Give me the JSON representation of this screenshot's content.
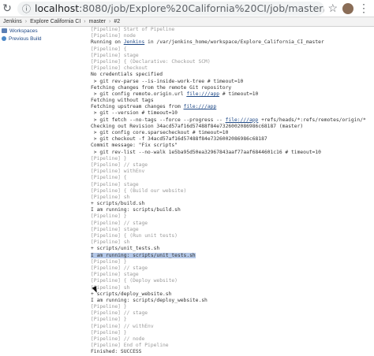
{
  "browser": {
    "url_host": "localhost",
    "url_path": ":8080/job/Explore%20California%20CI/job/master/2/console"
  },
  "breadcrumb": [
    "Jenkins",
    "Explore California CI",
    "master",
    "#2"
  ],
  "sidebar": {
    "items": [
      {
        "label": "Workspaces",
        "icon": "folder-icon"
      },
      {
        "label": "Previous Build",
        "icon": "build-icon"
      }
    ]
  },
  "console": {
    "lines": [
      {
        "text": "[Pipeline] Start of Pipeline",
        "kind": "pipeline"
      },
      {
        "text": "[Pipeline] node",
        "kind": "pipeline"
      },
      {
        "text": "Running on ",
        "link": "Jenkins",
        "after": " in /var/jenkins_home/workspace/Explore_California_CI_master",
        "kind": "normal"
      },
      {
        "text": "[Pipeline] {",
        "kind": "pipeline"
      },
      {
        "text": "[Pipeline] stage",
        "kind": "pipeline"
      },
      {
        "text": "[Pipeline] { (Declarative: Checkout SCM)",
        "kind": "pipeline"
      },
      {
        "text": "[Pipeline] checkout",
        "kind": "pipeline"
      },
      {
        "text": "No credentials specified",
        "kind": "normal"
      },
      {
        "text": " > git rev-parse --is-inside-work-tree # timeout=10",
        "kind": "normal"
      },
      {
        "text": "Fetching changes from the remote Git repository",
        "kind": "normal"
      },
      {
        "text": " > git config remote.origin.url ",
        "link": "file:///app",
        "after": " # timeout=10",
        "kind": "normal"
      },
      {
        "text": "Fetching without tags",
        "kind": "normal"
      },
      {
        "text": "Fetching upstream changes from ",
        "link": "file:///app",
        "after": "",
        "kind": "normal"
      },
      {
        "text": " > git --version # timeout=10",
        "kind": "normal"
      },
      {
        "text": " > git fetch --no-tags --force --progress -- ",
        "link": "file:///app",
        "after": " +refs/heads/*:refs/remotes/origin/*",
        "kind": "normal"
      },
      {
        "text": "Checking out Revision 34acd57af16d57488f84e7326002086986c68187 (master)",
        "kind": "normal"
      },
      {
        "text": " > git config core.sparsecheckout # timeout=10",
        "kind": "normal"
      },
      {
        "text": " > git checkout -f 34acd57af16d57488f84e7326002086986c68187",
        "kind": "normal"
      },
      {
        "text": "Commit message: \"Fix scripts\"",
        "kind": "normal"
      },
      {
        "text": " > git rev-list --no-walk 1e5ba95d50ea32967843aaf77aaf6844601c16 # timeout=10",
        "kind": "normal"
      },
      {
        "text": "[Pipeline] }",
        "kind": "pipeline"
      },
      {
        "text": "[Pipeline] // stage",
        "kind": "pipeline"
      },
      {
        "text": "[Pipeline] withEnv",
        "kind": "pipeline"
      },
      {
        "text": "[Pipeline] {",
        "kind": "pipeline"
      },
      {
        "text": "[Pipeline] stage",
        "kind": "pipeline"
      },
      {
        "text": "[Pipeline] { (Build our website)",
        "kind": "pipeline"
      },
      {
        "text": "[Pipeline] sh",
        "kind": "pipeline"
      },
      {
        "text": "+ scripts/build.sh",
        "kind": "normal"
      },
      {
        "text": "I am running: scripts/build.sh",
        "kind": "normal"
      },
      {
        "text": "[Pipeline] }",
        "kind": "pipeline"
      },
      {
        "text": "[Pipeline] // stage",
        "kind": "pipeline"
      },
      {
        "text": "[Pipeline] stage",
        "kind": "pipeline"
      },
      {
        "text": "[Pipeline] { (Run unit tests)",
        "kind": "pipeline"
      },
      {
        "text": "[Pipeline] sh",
        "kind": "pipeline"
      },
      {
        "text": "+ scripts/unit_tests.sh",
        "kind": "normal"
      },
      {
        "text": "I am running: scripts/unit_tests.sh",
        "kind": "highlight"
      },
      {
        "text": "[Pipeline] }",
        "kind": "pipeline"
      },
      {
        "text": "[Pipeline] // stage",
        "kind": "pipeline"
      },
      {
        "text": "[Pipeline] stage",
        "kind": "pipeline"
      },
      {
        "text": "[Pipeline] { (Deploy website)",
        "kind": "pipeline"
      },
      {
        "text": "[Pipeline] sh",
        "kind": "pipeline"
      },
      {
        "text": "+ scripts/deploy_website.sh",
        "kind": "normal"
      },
      {
        "text": "I am running: scripts/deploy_website.sh",
        "kind": "normal"
      },
      {
        "text": "[Pipeline] }",
        "kind": "pipeline"
      },
      {
        "text": "[Pipeline] // stage",
        "kind": "pipeline"
      },
      {
        "text": "[Pipeline] }",
        "kind": "pipeline"
      },
      {
        "text": "[Pipeline] // withEnv",
        "kind": "pipeline"
      },
      {
        "text": "[Pipeline] }",
        "kind": "pipeline"
      },
      {
        "text": "[Pipeline] // node",
        "kind": "pipeline"
      },
      {
        "text": "[Pipeline] End of Pipeline",
        "kind": "pipeline"
      },
      {
        "text": "Finished: SUCCESS",
        "kind": "normal"
      }
    ]
  }
}
